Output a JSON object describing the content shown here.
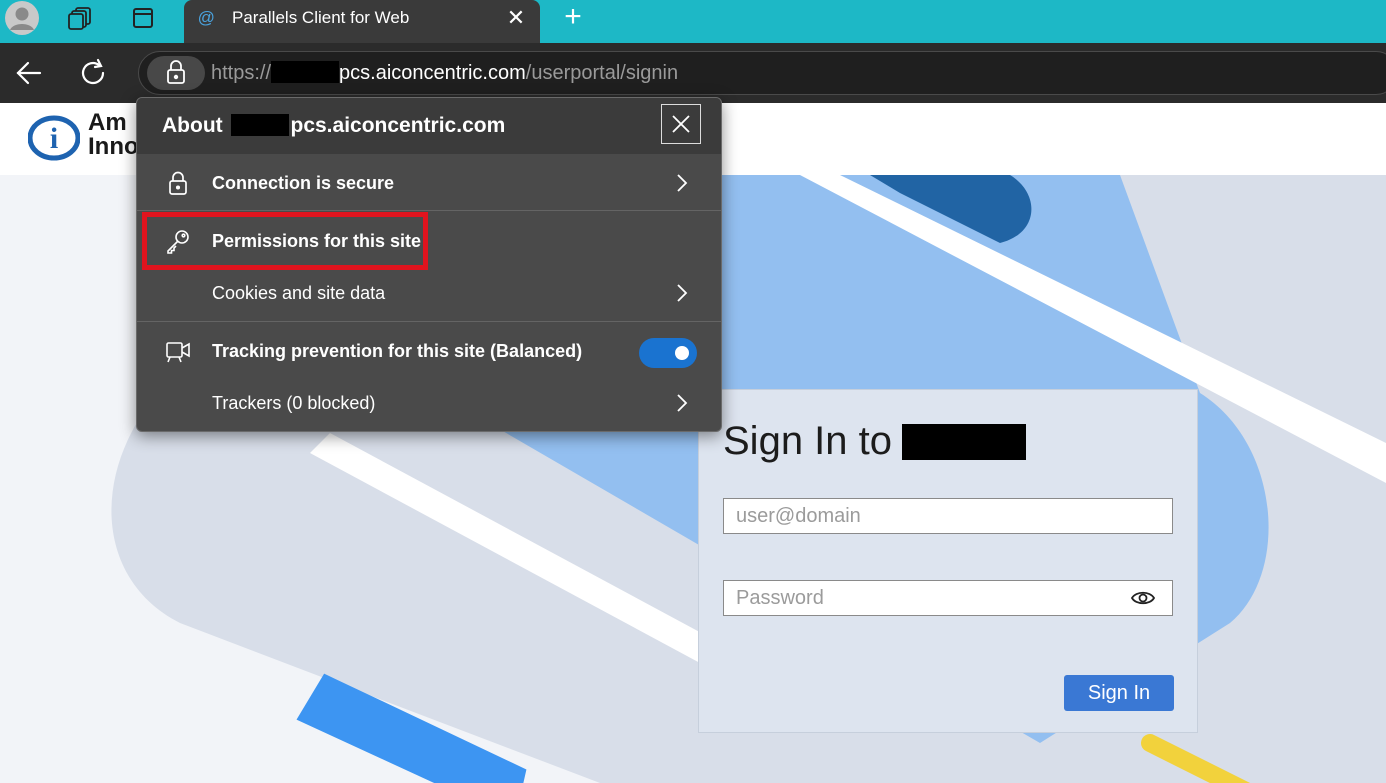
{
  "browser": {
    "tab_title": "Parallels Client for Web",
    "tab_favicon": "@",
    "url_scheme": "https://",
    "url_domain": "pcs.aiconcentric.com",
    "url_path": "/userportal/signin"
  },
  "popup": {
    "title_prefix": "About",
    "title_domain": "pcs.aiconcentric.com",
    "items": [
      {
        "label": "Connection is secure",
        "icon": "lock-icon"
      },
      {
        "label": "Permissions for this site",
        "icon": "key-icon"
      },
      {
        "label": "Cookies and site data",
        "icon": ""
      },
      {
        "label": "Tracking prevention for this site (Balanced)",
        "icon": "tracking-camera-icon",
        "toggle_on": true
      },
      {
        "label": "Trackers (0 blocked)",
        "icon": ""
      }
    ]
  },
  "page": {
    "logo_line1": "Am",
    "logo_line2": "Inno",
    "signin_title": "Sign In to",
    "username_placeholder": "user@domain",
    "password_placeholder": "Password",
    "signin_button": "Sign In"
  },
  "colors": {
    "tabstrip": "#1db8c6",
    "accent_blue": "#3a78d4",
    "highlight_red": "#e0141e"
  }
}
